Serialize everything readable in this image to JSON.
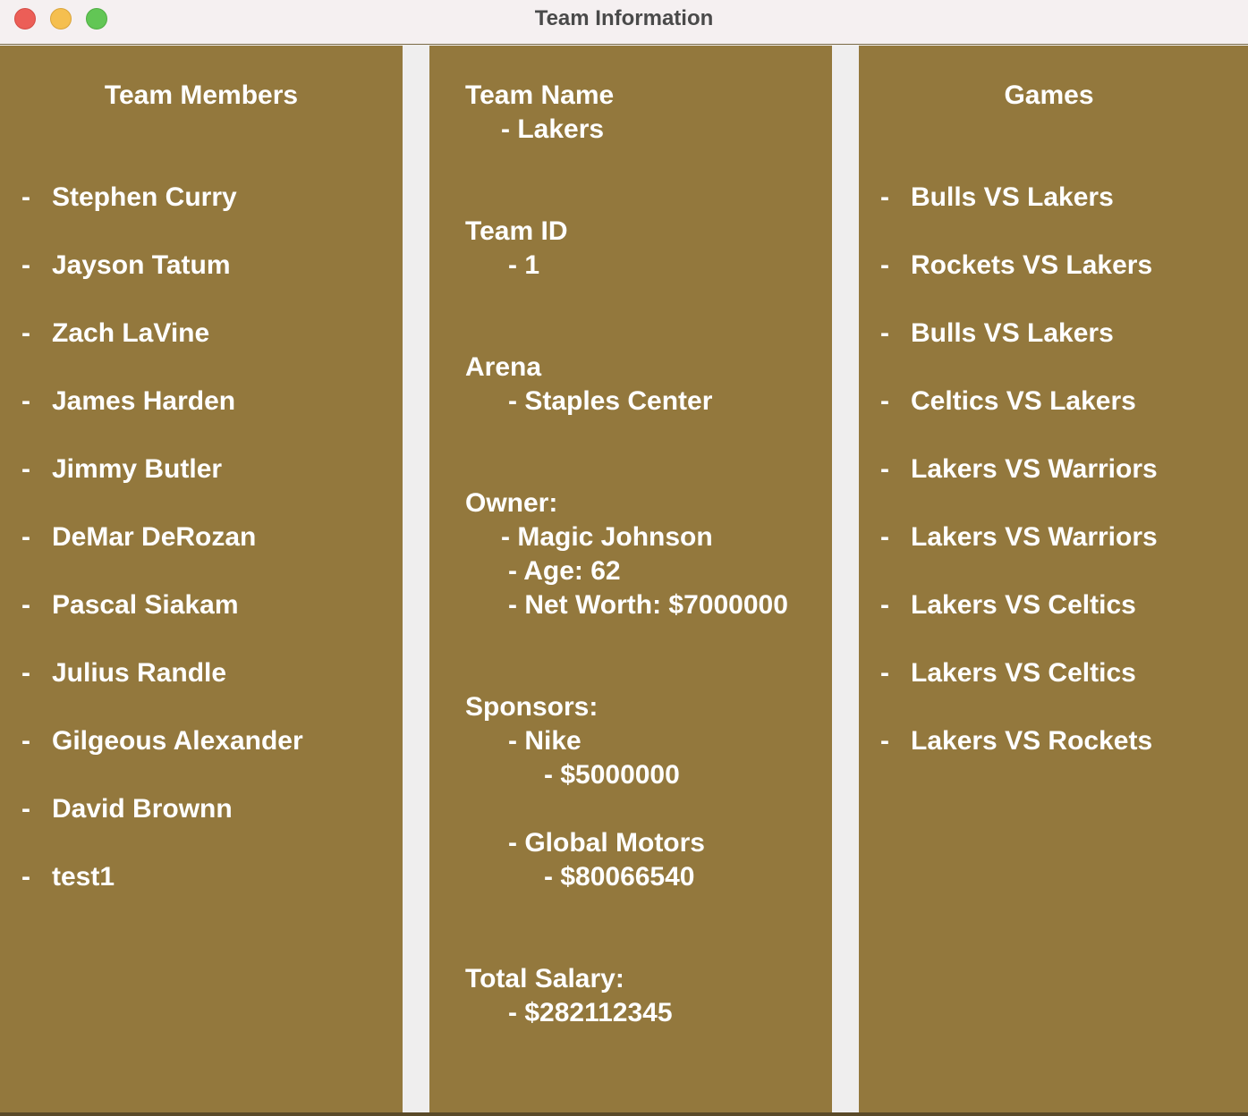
{
  "window": {
    "title": "Team Information"
  },
  "members_panel": {
    "heading": "Team Members",
    "bullet": "-",
    "items": [
      "Stephen Curry",
      "Jayson Tatum",
      "Zach LaVine",
      "James Harden",
      "Jimmy Butler",
      "DeMar DeRozan",
      "Pascal Siakam",
      "Julius Randle",
      "Gilgeous Alexander",
      "David Brownn",
      "test1"
    ]
  },
  "info_panel": {
    "team_name_label": "Team Name",
    "team_name_value": "- Lakers",
    "team_id_label": "Team ID",
    "team_id_value": "- 1",
    "arena_label": "Arena",
    "arena_value": "- Staples Center",
    "owner_label": "Owner:",
    "owner_name": "- Magic Johnson",
    "owner_age": "- Age: 62",
    "owner_net_worth": "- Net Worth: $7000000",
    "sponsors_label": "Sponsors:",
    "sponsors": [
      {
        "name": "- Nike",
        "amount": "- $5000000"
      },
      {
        "name": "- Global Motors",
        "amount": "- $80066540"
      }
    ],
    "total_salary_label": "Total Salary:",
    "total_salary_value": "- $282112345"
  },
  "games_panel": {
    "heading": "Games",
    "bullet": "-",
    "items": [
      "Bulls VS Lakers",
      "Rockets VS Lakers",
      "Bulls VS Lakers",
      "Celtics VS Lakers",
      "Lakers VS Warriors",
      "Lakers VS Warriors",
      "Lakers VS Celtics",
      "Lakers VS Celtics",
      "Lakers VS Rockets"
    ]
  }
}
